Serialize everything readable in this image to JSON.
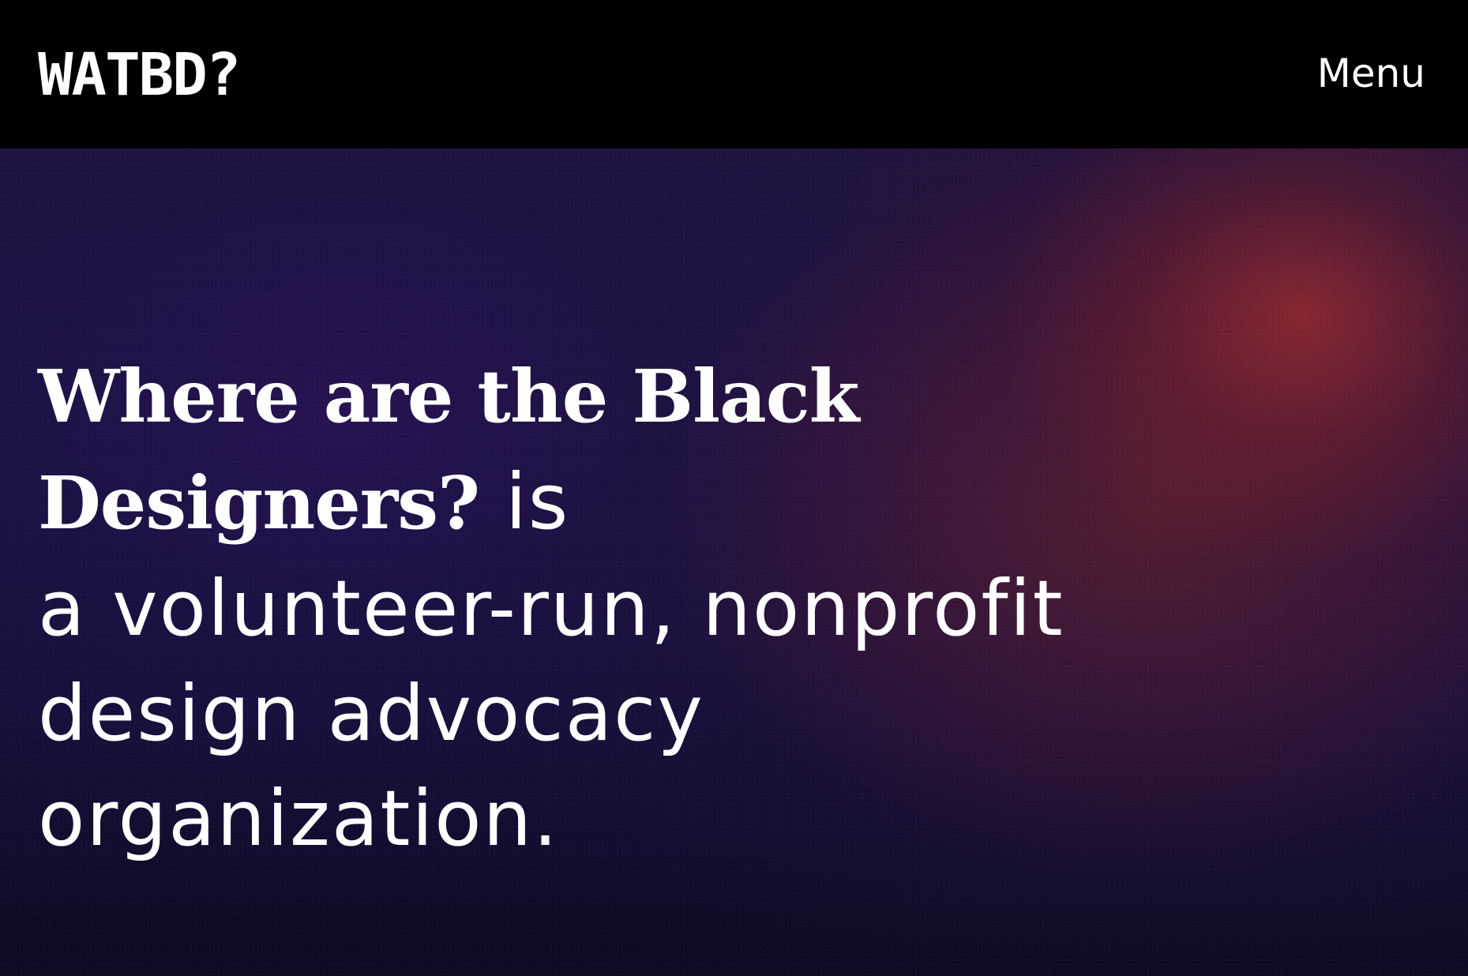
{
  "header": {
    "logo": "WATBD?",
    "menu_label": "Menu"
  },
  "hero": {
    "headline_title": "Where are the Black Designers?",
    "headline_line_1_rest": " is",
    "headline_line_2": "a volunteer-run, nonprofit",
    "headline_line_3": "design advocacy",
    "headline_line_4": "organization."
  },
  "colors": {
    "header_background": "#000000",
    "text": "#ffffff",
    "hero_gradient_purple": "#1b1345",
    "hero_gradient_red": "#d43726"
  }
}
